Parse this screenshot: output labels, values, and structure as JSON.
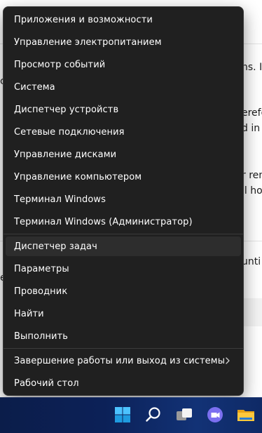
{
  "background_fragments": [
    "ns. If",
    "c",
    "erefo",
    "d in",
    "r ren",
    "ll ho",
    "unti",
    "e"
  ],
  "menu": {
    "items": [
      "Приложения и возможности",
      "Управление электропитанием",
      "Просмотр событий",
      "Система",
      "Диспетчер устройств",
      "Сетевые подключения",
      "Управление дисками",
      "Управление компьютером",
      "Терминал Windows",
      "Терминал Windows (Администратор)",
      "Диспетчер задач",
      "Параметры",
      "Проводник",
      "Найти",
      "Выполнить",
      "Завершение работы или выход из системы",
      "Рабочий стол"
    ],
    "hover_item": "Диспетчер задач"
  },
  "taskbar": {
    "icons": [
      "windows-start-icon",
      "search-icon",
      "task-view-icon",
      "teams-chat-icon",
      "file-explorer-icon"
    ],
    "accent": "#0c2158"
  },
  "colors": {
    "menu_bg": "#202020",
    "menu_text": "#ffffff",
    "hover_bg": "#2d2d2d"
  }
}
